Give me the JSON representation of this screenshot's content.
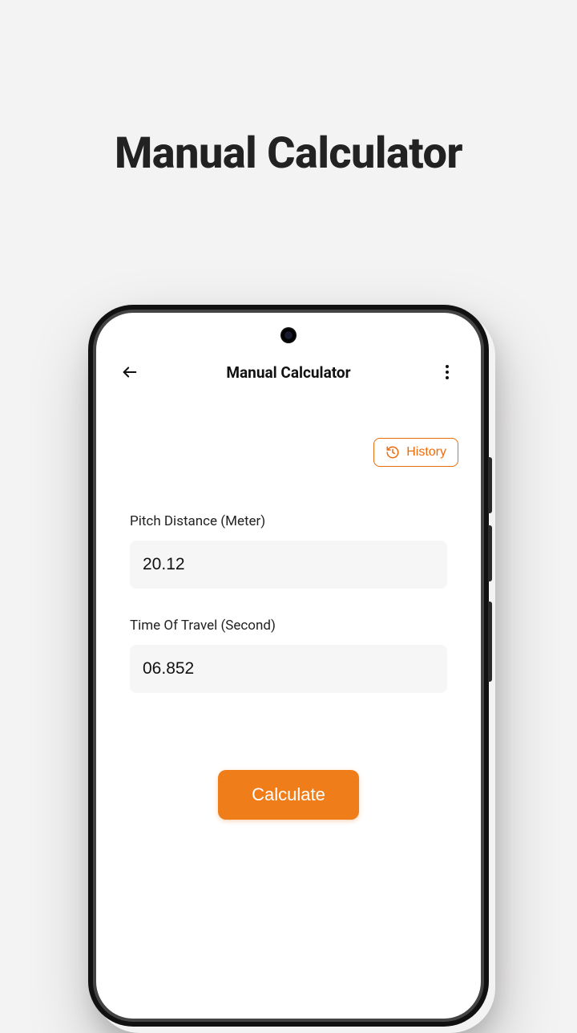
{
  "page": {
    "title": "Manual Calculator"
  },
  "header": {
    "title": "Manual Calculator"
  },
  "history": {
    "label": "History"
  },
  "form": {
    "pitch_label": "Pitch Distance (Meter)",
    "pitch_value": "20.12",
    "time_label": "Time Of Travel (Second)",
    "time_value": "06.852"
  },
  "actions": {
    "calculate": "Calculate"
  },
  "colors": {
    "accent": "#ef7e1a",
    "accent_border": "#ed6c0c"
  }
}
